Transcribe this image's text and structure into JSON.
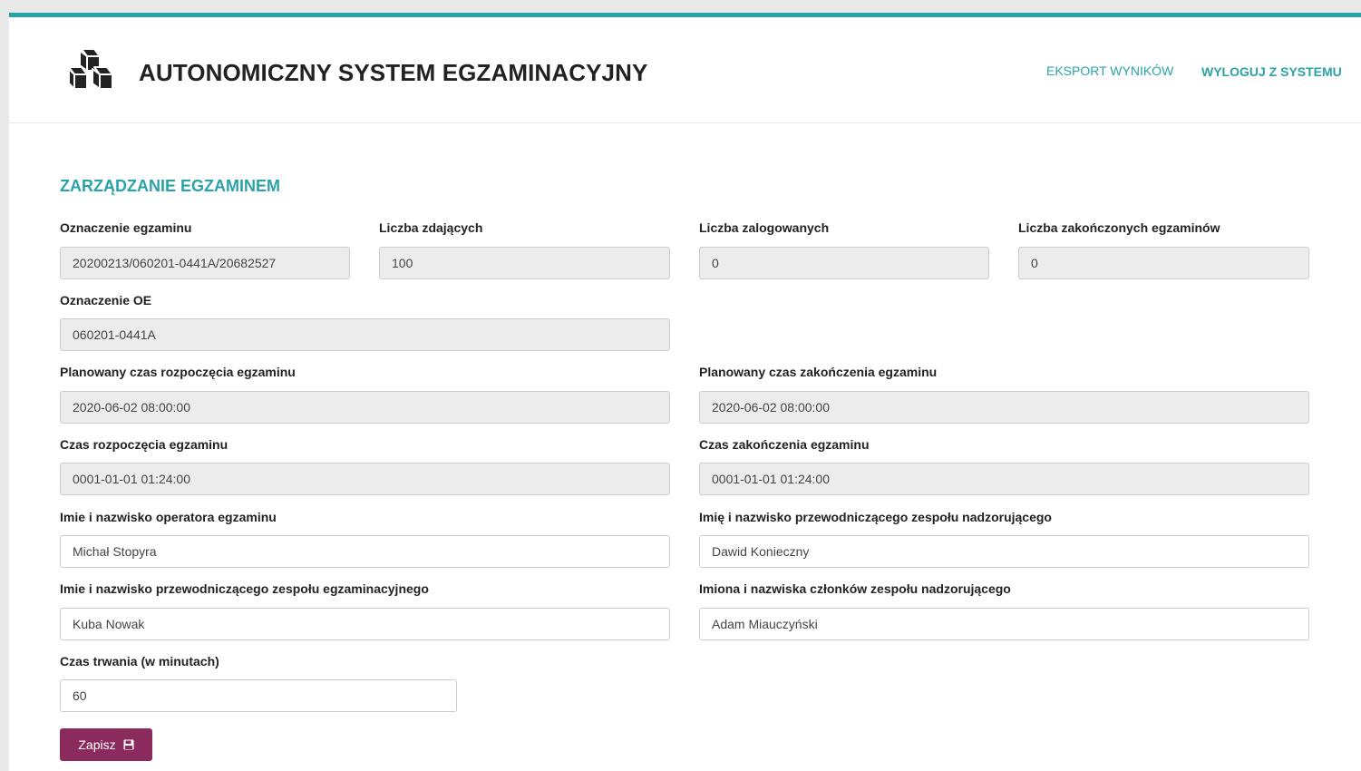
{
  "header": {
    "app_title": "AUTONOMICZNY SYSTEM EGZAMINACYJNY",
    "logo_icon": "cubes-icon",
    "nav": {
      "export_results": "EKSPORT WYNIKÓW",
      "logout": "WYLOGUJ Z SYSTEMU"
    }
  },
  "colors": {
    "accent": "#2aa3a8",
    "button": "#8b2a5c",
    "readonly_field": "#ececec"
  },
  "section": {
    "title": "ZARZĄDZANIE EGZAMINEM"
  },
  "fields": {
    "exam_id": {
      "label": "Oznaczenie egzaminu",
      "value": "20200213/060201-0441A/20682527"
    },
    "candidates_count": {
      "label": "Liczba zdających",
      "value": "100"
    },
    "logged_in_count": {
      "label": "Liczba zalogowanych",
      "value": "0"
    },
    "finished_count": {
      "label": "Liczba zakończonych egzaminów",
      "value": "0"
    },
    "oe_id": {
      "label": "Oznaczenie OE",
      "value": "060201-0441A"
    },
    "planned_start": {
      "label": "Planowany czas rozpoczęcia egzaminu",
      "value": "2020-06-02 08:00:00"
    },
    "planned_end": {
      "label": "Planowany czas zakończenia egzaminu",
      "value": "2020-06-02 08:00:00"
    },
    "actual_start": {
      "label": "Czas rozpoczęcia egzaminu",
      "value": "0001-01-01 01:24:00"
    },
    "actual_end": {
      "label": "Czas zakończenia egzaminu",
      "value": "0001-01-01 01:24:00"
    },
    "operator_name": {
      "label": "Imie i nazwisko operatora egzaminu",
      "value": "Michał Stopyra"
    },
    "supervisory_chair": {
      "label": "Imię i nazwisko przewodniczącego zespołu nadzorującego",
      "value": "Dawid Konieczny"
    },
    "exam_team_chair": {
      "label": "Imie i nazwisko przewodniczącego zespołu egzaminacyjnego",
      "value": "Kuba Nowak"
    },
    "supervisory_members": {
      "label": "Imiona i nazwiska członków zespołu nadzorującego",
      "value": "Adam Miauczyński"
    },
    "duration": {
      "label": "Czas trwania (w minutach)",
      "value": "60"
    }
  },
  "save_button": {
    "label": "Zapisz",
    "icon": "floppy-disk-icon"
  }
}
